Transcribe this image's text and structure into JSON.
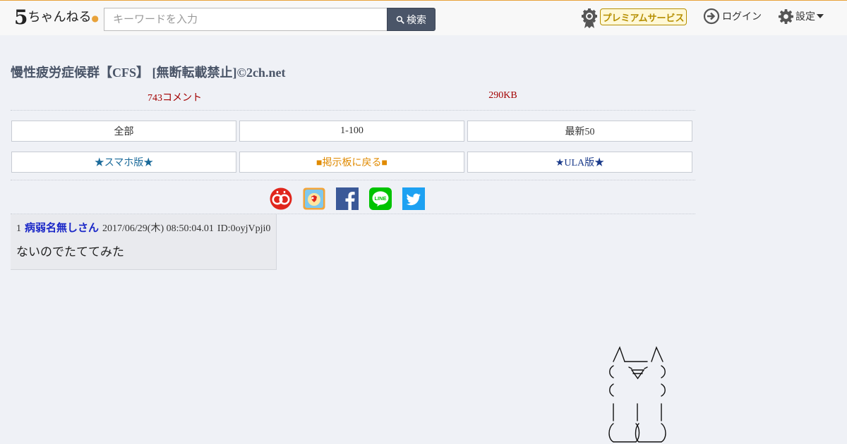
{
  "header": {
    "logo_text": "5ちゃんねる",
    "search_placeholder": "キーワードを入力",
    "search_label": "検索",
    "premium_label": "プレミアムサービス",
    "login_label": "ログイン",
    "settings_label": "設定"
  },
  "thread": {
    "title": "慢性疲労症候群【CFS】 [無断転載禁止]©2ch.net",
    "comments": "743コメント",
    "size": "290KB"
  },
  "nav": {
    "row1": [
      "全部",
      "1-100",
      "最新50"
    ],
    "row2": [
      "★スマホ版★",
      "■掲示板に戻る■",
      "★ULA版★"
    ]
  },
  "share_icons": [
    "sumaho-99-icon",
    "app-icon",
    "facebook-icon",
    "line-icon",
    "twitter-icon"
  ],
  "posts": [
    {
      "number": "1",
      "name": "病弱名無しさん",
      "date": "2017/06/29(木) 08:50:04.01",
      "id": "ID:0oyjVpji0",
      "body": "ないのでたててみた"
    }
  ],
  "colors": {
    "accent": "#e8a23a",
    "title": "#4a5568",
    "meta_red": "#a30000",
    "name_blue": "#1a27c7"
  }
}
